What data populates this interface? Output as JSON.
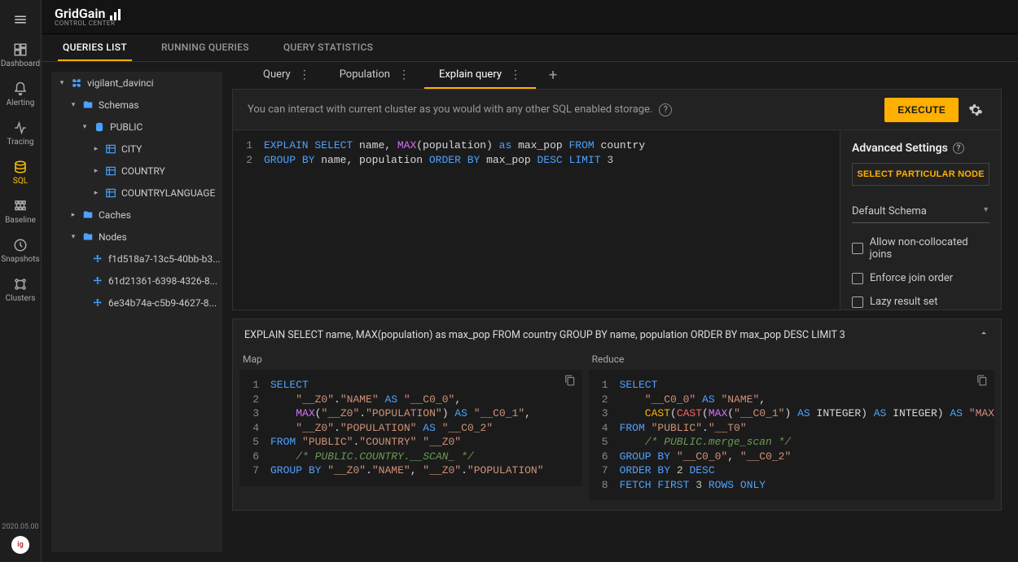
{
  "brand": {
    "name": "GridGain",
    "subtitle": "CONTROL CENTER"
  },
  "nav": {
    "items": [
      {
        "id": "dashboard",
        "label": "Dashboard"
      },
      {
        "id": "alerting",
        "label": "Alerting"
      },
      {
        "id": "tracing",
        "label": "Tracing"
      },
      {
        "id": "sql",
        "label": "SQL",
        "active": true
      },
      {
        "id": "baseline",
        "label": "Baseline"
      },
      {
        "id": "snapshots",
        "label": "Snapshots"
      },
      {
        "id": "clusters",
        "label": "Clusters"
      }
    ],
    "version": "2020.05.00"
  },
  "top_tabs": [
    {
      "label": "QUERIES LIST",
      "active": true
    },
    {
      "label": "RUNNING QUERIES"
    },
    {
      "label": "QUERY STATISTICS"
    }
  ],
  "tree": {
    "root": "vigilant_davinci",
    "schemas": {
      "label": "Schemas",
      "public": {
        "label": "PUBLIC",
        "tables": [
          "CITY",
          "COUNTRY",
          "COUNTRYLANGUAGE"
        ]
      }
    },
    "caches": {
      "label": "Caches"
    },
    "nodes": {
      "label": "Nodes",
      "items": [
        "f1d518a7-13c5-40bb-b3...",
        "61d21361-6398-4326-8...",
        "6e34b74a-c5b9-4627-8..."
      ]
    }
  },
  "query_tabs": [
    {
      "label": "Query"
    },
    {
      "label": "Population"
    },
    {
      "label": "Explain query",
      "active": true
    }
  ],
  "info_text": "You can interact with current cluster as you would with any other SQL enabled storage.",
  "execute_label": "EXECUTE",
  "editor": {
    "lines": [
      [
        {
          "kw": "EXPLAIN"
        },
        " ",
        {
          "kw": "SELECT"
        },
        " name, ",
        {
          "fn": "MAX"
        },
        "(population) ",
        {
          "kw": "as"
        },
        " max_pop ",
        {
          "kw": "FROM"
        },
        " country"
      ],
      [
        {
          "kw": "GROUP"
        },
        " ",
        {
          "kw": "BY"
        },
        " name, population ",
        {
          "kw": "ORDER"
        },
        " ",
        {
          "kw": "BY"
        },
        " max_pop ",
        {
          "kw": "DESC"
        },
        " ",
        {
          "kw": "LIMIT"
        },
        " ",
        {
          "num": "3"
        }
      ]
    ]
  },
  "settings": {
    "title": "Advanced Settings",
    "pick_node": "SELECT PARTICULAR NODE",
    "schema": "Default Schema",
    "opts": [
      "Allow non-collocated joins",
      "Enforce join order",
      "Lazy result set"
    ]
  },
  "result": {
    "header": "EXPLAIN SELECT name, MAX(population) as max_pop FROM country GROUP BY name, population ORDER BY max_pop DESC LIMIT 3",
    "map_label": "Map",
    "reduce_label": "Reduce",
    "map": [
      [
        {
          "kw": "SELECT"
        }
      ],
      [
        "    ",
        {
          "str": "\"__Z0\""
        },
        ".",
        {
          "str": "\"NAME\""
        },
        " ",
        {
          "kw": "AS"
        },
        " ",
        {
          "str": "\"__C0_0\""
        },
        ","
      ],
      [
        "    ",
        {
          "fn": "MAX"
        },
        "(",
        {
          "str": "\"__Z0\""
        },
        ".",
        {
          "str": "\"POPULATION\""
        },
        ") ",
        {
          "kw": "AS"
        },
        " ",
        {
          "str": "\"__C0_1\""
        },
        ","
      ],
      [
        "    ",
        {
          "str": "\"__Z0\""
        },
        ".",
        {
          "str": "\"POPULATION\""
        },
        " ",
        {
          "kw": "AS"
        },
        " ",
        {
          "str": "\"__C0_2\""
        }
      ],
      [
        {
          "kw": "FROM"
        },
        " ",
        {
          "str": "\"PUBLIC\""
        },
        ".",
        {
          "str": "\"COUNTRY\""
        },
        " ",
        {
          "str": "\"__Z0\""
        }
      ],
      [
        "    ",
        {
          "cm": "/* PUBLIC.COUNTRY.__SCAN_ */"
        }
      ],
      [
        {
          "kw": "GROUP"
        },
        " ",
        {
          "kw": "BY"
        },
        " ",
        {
          "str": "\"__Z0\""
        },
        ".",
        {
          "str": "\"NAME\""
        },
        ", ",
        {
          "str": "\"__Z0\""
        },
        ".",
        {
          "str": "\"POPULATION\""
        }
      ]
    ],
    "reduce": [
      [
        {
          "kw": "SELECT"
        }
      ],
      [
        "    ",
        {
          "str": "\"__C0_0\""
        },
        " ",
        {
          "kw": "AS"
        },
        " ",
        {
          "str": "\"NAME\""
        },
        ","
      ],
      [
        "    ",
        {
          "fn3": "CAST"
        },
        "(",
        {
          "fn2": "CAST"
        },
        "(",
        {
          "fn": "MAX"
        },
        "(",
        {
          "str": "\"__C0_1\""
        },
        ") ",
        {
          "kw": "AS"
        },
        " INTEGER) ",
        {
          "kw": "AS"
        },
        " INTEGER) ",
        {
          "kw": "AS"
        },
        " ",
        {
          "str": "\"MAX"
        }
      ],
      [
        {
          "kw": "FROM"
        },
        " ",
        {
          "str": "\"PUBLIC\""
        },
        ".",
        {
          "str": "\"__T0\""
        }
      ],
      [
        "    ",
        {
          "cm": "/* PUBLIC.merge_scan */"
        }
      ],
      [
        {
          "kw": "GROUP"
        },
        " ",
        {
          "kw": "BY"
        },
        " ",
        {
          "str": "\"__C0_0\""
        },
        ", ",
        {
          "str": "\"__C0_2\""
        }
      ],
      [
        {
          "kw": "ORDER"
        },
        " ",
        {
          "kw": "BY"
        },
        " ",
        {
          "num": "2"
        },
        " ",
        {
          "kw": "DESC"
        }
      ],
      [
        {
          "kw": "FETCH"
        },
        " ",
        {
          "kw": "FIRST"
        },
        " ",
        {
          "num": "3"
        },
        " ",
        {
          "kw": "ROWS"
        },
        " ",
        {
          "kw": "ONLY"
        }
      ]
    ]
  }
}
